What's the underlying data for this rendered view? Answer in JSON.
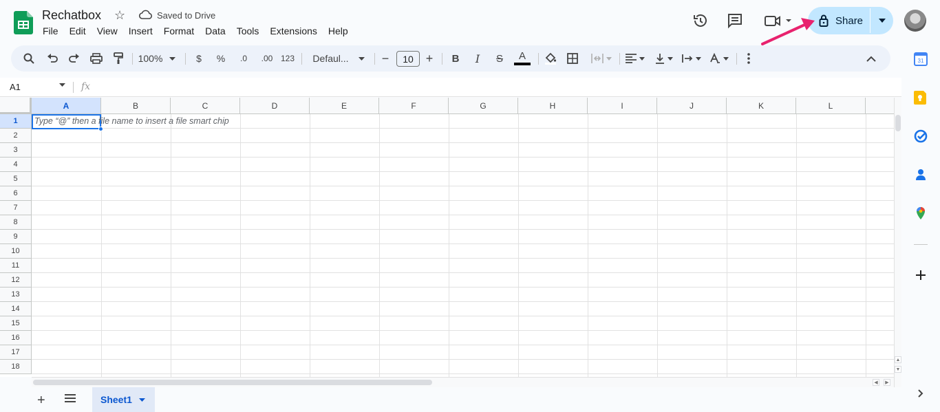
{
  "doc": {
    "title": "Rechatbox",
    "save_status": "Saved to Drive"
  },
  "menu": [
    "File",
    "Edit",
    "View",
    "Insert",
    "Format",
    "Data",
    "Tools",
    "Extensions",
    "Help"
  ],
  "share": {
    "label": "Share"
  },
  "toolbar": {
    "zoom": "100%",
    "currency": "$",
    "percent": "%",
    "decrease_decimal": ".0",
    "increase_decimal": ".00",
    "number_format": "123",
    "font": "Defaul...",
    "font_size": "10",
    "bold": "B",
    "italic": "I",
    "strike": "S",
    "text_color": "A"
  },
  "formula_bar": {
    "name_box": "A1",
    "fx": "fx"
  },
  "columns": [
    "A",
    "B",
    "C",
    "D",
    "E",
    "F",
    "G",
    "H",
    "I",
    "J",
    "K",
    "L"
  ],
  "rows": [
    "1",
    "2",
    "3",
    "4",
    "5",
    "6",
    "7",
    "8",
    "9",
    "10",
    "11",
    "12",
    "13",
    "14",
    "15",
    "16",
    "17",
    "18"
  ],
  "active_cell": {
    "ref": "A1",
    "hint": "Type “@” then a file name to insert a file smart chip"
  },
  "sheets": [
    {
      "name": "Sheet1",
      "active": true
    }
  ],
  "colors": {
    "share_bg": "#c2e7ff",
    "accent": "#1a73e8",
    "annotation_arrow": "#e8226e",
    "selected_header": "#d3e3fd"
  }
}
